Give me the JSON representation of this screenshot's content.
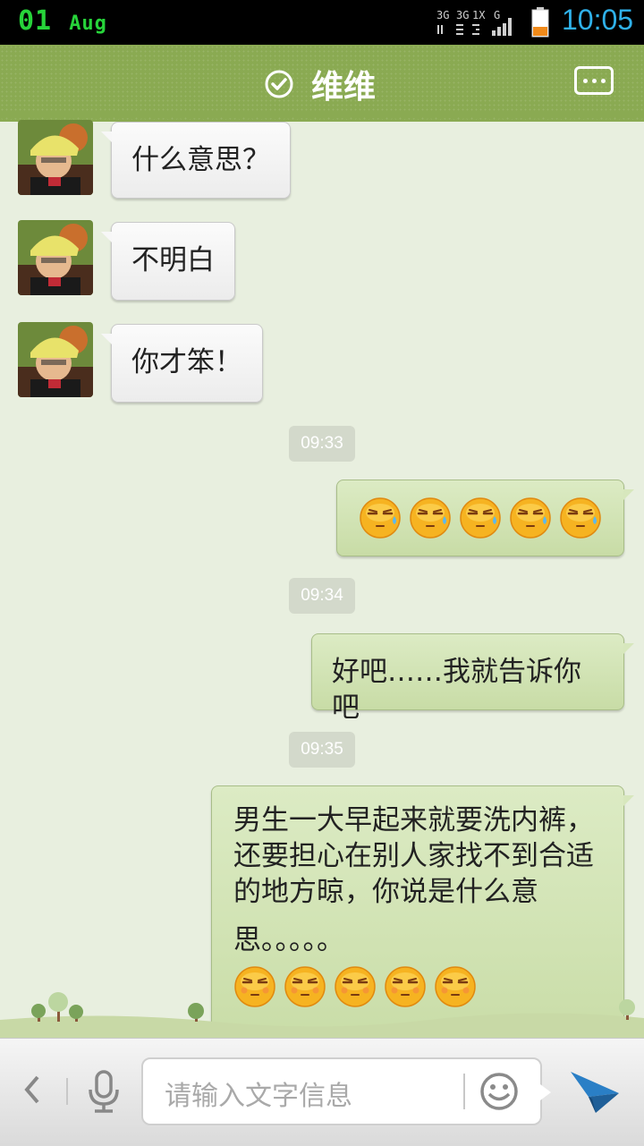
{
  "status_bar": {
    "date_day": "01",
    "date_month": "Aug",
    "time": "10:05",
    "network_labels": [
      "3G",
      "3G",
      "1X",
      "G"
    ]
  },
  "header": {
    "title": "维维",
    "title_icon": "check-circle-icon",
    "more_icon": "more-options-icon"
  },
  "messages": [
    {
      "sender": "friend",
      "text": "什么意思？"
    },
    {
      "sender": "friend",
      "text": "不明白"
    },
    {
      "sender": "friend",
      "text": "你才笨！"
    },
    {
      "type": "timestamp",
      "text": "09:33"
    },
    {
      "sender": "me",
      "emoji": [
        "sweat-emoji",
        "sweat-emoji",
        "sweat-emoji",
        "sweat-emoji",
        "sweat-emoji"
      ]
    },
    {
      "type": "timestamp",
      "text": "09:34"
    },
    {
      "sender": "me",
      "text": "好吧……我就告诉你吧"
    },
    {
      "type": "timestamp",
      "text": "09:35"
    },
    {
      "sender": "me",
      "text": "男生一大早起来就要洗内裤，还要担心在别人家找不到合适的地方晾，你说是什么意",
      "text_tail": "思。。。。。",
      "emoji": [
        "smug-emoji",
        "smug-emoji",
        "smug-emoji",
        "smug-emoji",
        "smug-emoji"
      ]
    }
  ],
  "input_bar": {
    "placeholder": "请输入文字信息",
    "back_icon": "chevron-left-icon",
    "voice_icon": "microphone-icon",
    "emoji_icon": "smiley-icon",
    "send_icon": "send-icon"
  },
  "colors": {
    "header": "#8aaa52",
    "background": "#e8efdf",
    "outgoing_bubble": "#d0e2b2",
    "incoming_bubble": "#f4f4f4",
    "time_accent": "#2fb1ea",
    "date_accent": "#27d43a"
  }
}
